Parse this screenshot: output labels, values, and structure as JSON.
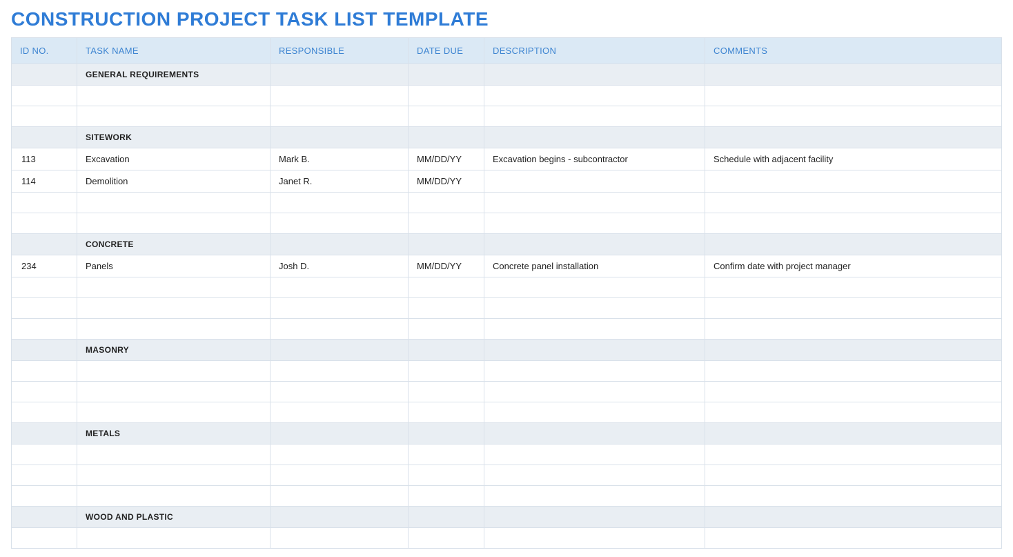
{
  "title": "CONSTRUCTION PROJECT TASK LIST TEMPLATE",
  "columns": {
    "id": "ID NO.",
    "task": "TASK NAME",
    "responsible": "RESPONSIBLE",
    "due": "DATE DUE",
    "description": "DESCRIPTION",
    "comments": "COMMENTS"
  },
  "sections": [
    {
      "name": "GENERAL REQUIREMENTS",
      "rows": [
        {
          "id": "",
          "task": "",
          "responsible": "",
          "due": "",
          "description": "",
          "comments": ""
        },
        {
          "id": "",
          "task": "",
          "responsible": "",
          "due": "",
          "description": "",
          "comments": ""
        }
      ]
    },
    {
      "name": "SITEWORK",
      "rows": [
        {
          "id": "113",
          "task": "Excavation",
          "responsible": "Mark B.",
          "due": "MM/DD/YY",
          "description": "Excavation begins - subcontractor",
          "comments": "Schedule with adjacent facility"
        },
        {
          "id": "114",
          "task": "Demolition",
          "responsible": "Janet R.",
          "due": "MM/DD/YY",
          "description": "",
          "comments": ""
        },
        {
          "id": "",
          "task": "",
          "responsible": "",
          "due": "",
          "description": "",
          "comments": ""
        },
        {
          "id": "",
          "task": "",
          "responsible": "",
          "due": "",
          "description": "",
          "comments": ""
        }
      ]
    },
    {
      "name": "CONCRETE",
      "rows": [
        {
          "id": "234",
          "task": "Panels",
          "responsible": "Josh D.",
          "due": "MM/DD/YY",
          "description": "Concrete panel installation",
          "comments": "Confirm date with project manager"
        },
        {
          "id": "",
          "task": "",
          "responsible": "",
          "due": "",
          "description": "",
          "comments": ""
        },
        {
          "id": "",
          "task": "",
          "responsible": "",
          "due": "",
          "description": "",
          "comments": ""
        },
        {
          "id": "",
          "task": "",
          "responsible": "",
          "due": "",
          "description": "",
          "comments": ""
        }
      ]
    },
    {
      "name": "MASONRY",
      "rows": [
        {
          "id": "",
          "task": "",
          "responsible": "",
          "due": "",
          "description": "",
          "comments": ""
        },
        {
          "id": "",
          "task": "",
          "responsible": "",
          "due": "",
          "description": "",
          "comments": ""
        },
        {
          "id": "",
          "task": "",
          "responsible": "",
          "due": "",
          "description": "",
          "comments": ""
        }
      ]
    },
    {
      "name": "METALS",
      "rows": [
        {
          "id": "",
          "task": "",
          "responsible": "",
          "due": "",
          "description": "",
          "comments": ""
        },
        {
          "id": "",
          "task": "",
          "responsible": "",
          "due": "",
          "description": "",
          "comments": ""
        },
        {
          "id": "",
          "task": "",
          "responsible": "",
          "due": "",
          "description": "",
          "comments": ""
        }
      ]
    },
    {
      "name": "WOOD AND PLASTIC",
      "rows": [
        {
          "id": "",
          "task": "",
          "responsible": "",
          "due": "",
          "description": "",
          "comments": ""
        }
      ]
    }
  ]
}
